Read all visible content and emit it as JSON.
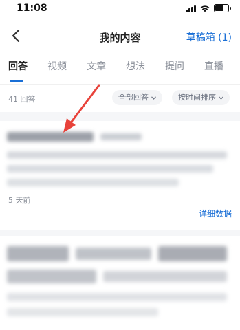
{
  "status_bar": {
    "time": "11:08"
  },
  "nav": {
    "title": "我的内容",
    "draft_label": "草稿箱 (1)",
    "back_icon": "chevron-left-icon"
  },
  "tabs": [
    {
      "label": "回答",
      "active": true
    },
    {
      "label": "视频"
    },
    {
      "label": "文章"
    },
    {
      "label": "想法"
    },
    {
      "label": "提问"
    },
    {
      "label": "直播"
    }
  ],
  "filter": {
    "count_label": "41 回答",
    "scope_label": "全部回答",
    "sort_label": "按时间排序"
  },
  "answers": [
    {
      "time_label": "5 天前",
      "detail_label": "详细数据"
    }
  ],
  "colors": {
    "accent": "#1a6fd6",
    "arrow": "#e8423a"
  }
}
